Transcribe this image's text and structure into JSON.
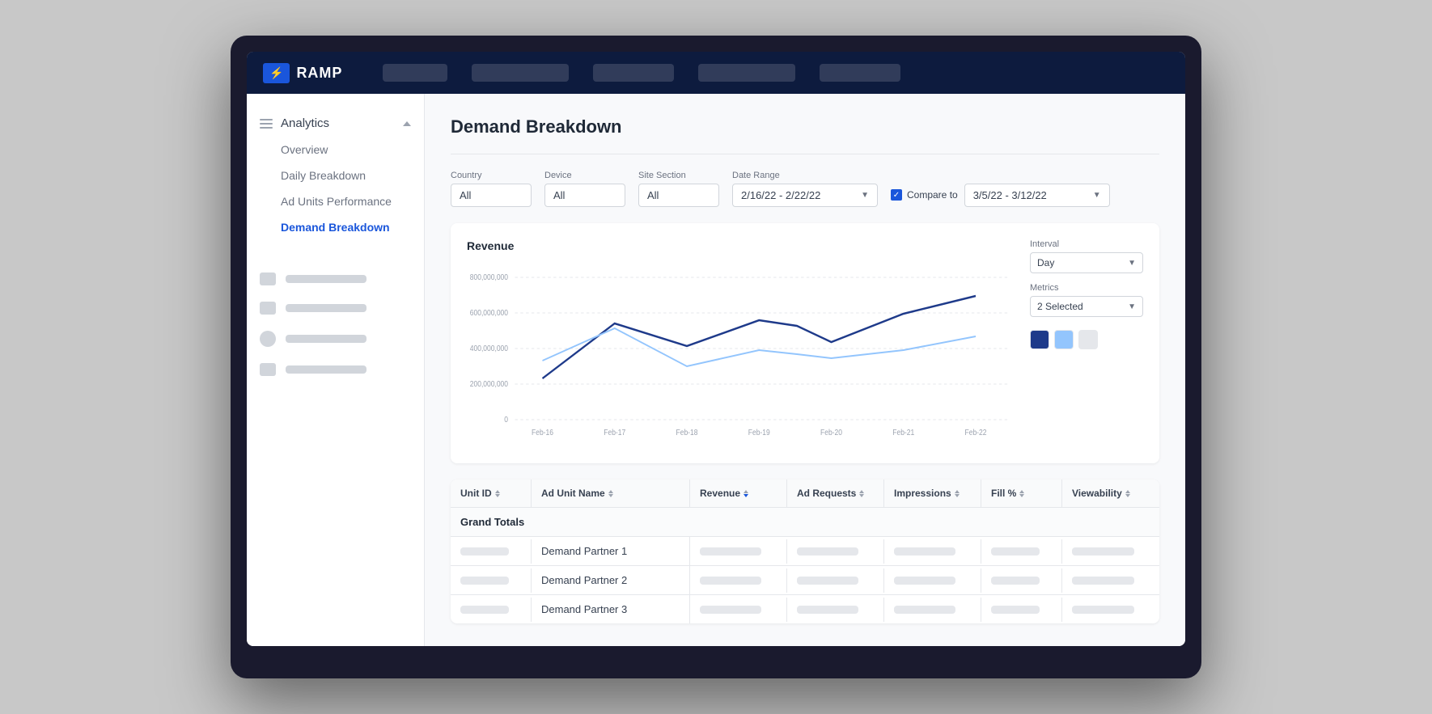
{
  "app": {
    "logo_text": "RAMP",
    "logo_icon": "⚡"
  },
  "top_nav": {
    "pills": [
      "",
      "",
      "",
      "",
      ""
    ]
  },
  "sidebar": {
    "analytics_label": "Analytics",
    "overview_label": "Overview",
    "daily_breakdown_label": "Daily Breakdown",
    "ad_units_performance_label": "Ad Units Performance",
    "demand_breakdown_label": "Demand Breakdown",
    "other_items": [
      {
        "icon": "video",
        "label": ""
      },
      {
        "icon": "chart",
        "label": ""
      },
      {
        "icon": "gear",
        "label": ""
      },
      {
        "icon": "list",
        "label": ""
      }
    ]
  },
  "page": {
    "title": "Demand Breakdown"
  },
  "filters": {
    "country_label": "Country",
    "country_value": "All",
    "device_label": "Device",
    "device_value": "All",
    "site_section_label": "Site Section",
    "site_section_value": "All",
    "date_range_label": "Date Range",
    "date_range_value": "2/16/22 - 2/22/22",
    "compare_label": "Compare to",
    "compare_value": "3/5/22 - 3/12/22"
  },
  "chart": {
    "title": "Revenue",
    "y_labels": [
      "800,000,000",
      "600,000,000",
      "400,000,000",
      "200,000,000",
      "0"
    ],
    "x_labels": [
      "Feb-16",
      "Feb-17",
      "Feb-18",
      "Feb-19",
      "Feb-20",
      "Feb-21",
      "Feb-22"
    ],
    "interval_label": "Interval",
    "interval_value": "Day",
    "metrics_label": "Metrics",
    "metrics_value": "2 Selected"
  },
  "table": {
    "columns": [
      "Unit ID",
      "Ad Unit Name",
      "Revenue",
      "Ad Requests",
      "Impressions",
      "Fill %",
      "Viewability"
    ],
    "grand_totals_label": "Grand Totals",
    "rows": [
      {
        "name": "Demand Partner 1"
      },
      {
        "name": "Demand Partner 2"
      },
      {
        "name": "Demand Partner 3"
      }
    ]
  }
}
